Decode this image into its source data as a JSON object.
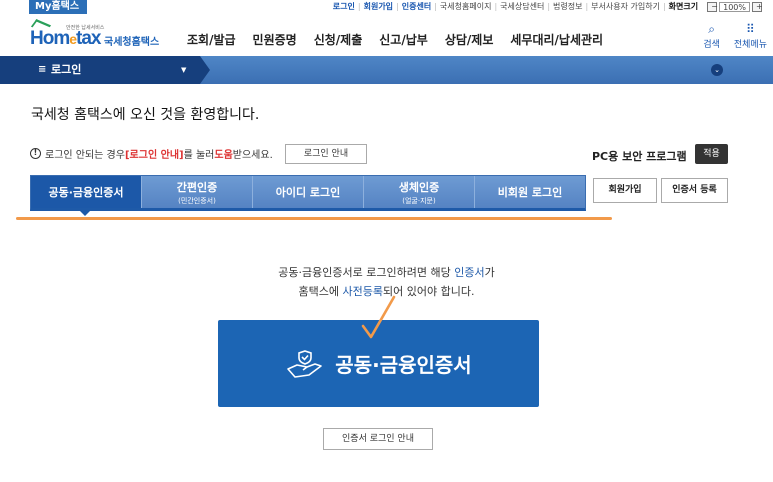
{
  "util": {
    "my_hometax": "My홈택스",
    "links": [
      "로그인",
      "회원가입",
      "인증센터",
      "국세청홈페이지",
      "국세상담센터",
      "법령정보",
      "부서사용자 가입하기",
      "화면크기"
    ],
    "zoom": "100%"
  },
  "header": {
    "logo_main": "Hom",
    "logo_e": "e",
    "logo_tax": "tax",
    "logo_tag": "안전한 납세서비스",
    "logo_name": "국세청홈택스",
    "menu": [
      "조회/발급",
      "민원증명",
      "신청/제출",
      "신고/납부",
      "상담/제보",
      "세무대리/납세관리"
    ],
    "search_label": "검색",
    "allmenu_label": "전체메뉴"
  },
  "strip": {
    "crumb_label": "로그인"
  },
  "welcome": "국세청 홈택스에 오신 것을 환영합니다.",
  "notice": {
    "pre": "로그인 안되는 경우 ",
    "red1": "[로그인 안내]",
    "mid": "를 눌러 ",
    "red2": "도움",
    "post": "받으세요.",
    "button": "로그인 안내"
  },
  "pc_security": {
    "label": "PC용 보안 프로그램",
    "apply": "적용"
  },
  "tabs": [
    {
      "label": "공동·금융인증서",
      "sub": ""
    },
    {
      "label": "간편인증",
      "sub": "(민간인증서)"
    },
    {
      "label": "아이디 로그인",
      "sub": ""
    },
    {
      "label": "생체인증",
      "sub": "(얼굴·지문)"
    },
    {
      "label": "비회원 로그인",
      "sub": ""
    }
  ],
  "side_buttons": {
    "join": "회원가입",
    "cert_register": "인증서 등록"
  },
  "desc": {
    "line1_pre": "공동·금융인증서로 로그인하려면 해당 ",
    "line1_hl": "인증서",
    "line1_post": "가",
    "line2_pre": "홈택스에 ",
    "line2_hl": "사전등록",
    "line2_post": "되어 있어야 합니다."
  },
  "big_button": "공동·금융인증서",
  "cert_guide": "인증서 로그인 안내",
  "colors": {
    "primary": "#1c65b4",
    "accent": "#f29a4a",
    "dark_nav": "#163f7d"
  }
}
